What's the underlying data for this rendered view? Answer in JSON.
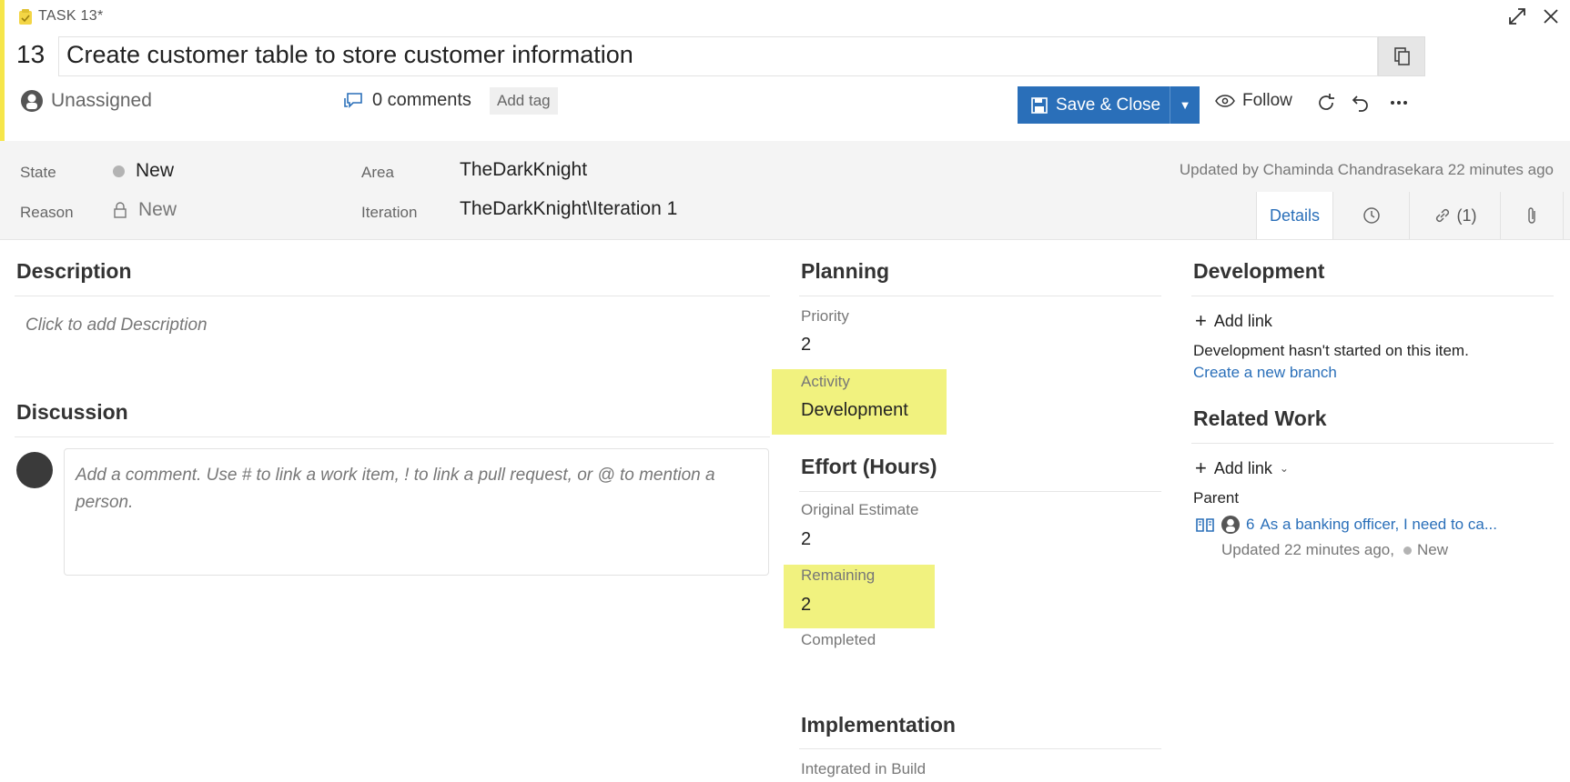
{
  "header": {
    "task_label": "TASK 13*",
    "work_item_id": "13",
    "title": "Create customer table to store customer information",
    "assigned_to": "Unassigned",
    "comments": "0 comments",
    "add_tag": "Add tag",
    "save_close": "Save & Close",
    "follow": "Follow"
  },
  "fields": {
    "state_label": "State",
    "state_value": "New",
    "reason_label": "Reason",
    "reason_value": "New",
    "area_label": "Area",
    "area_value": "TheDarkKnight",
    "iteration_label": "Iteration",
    "iteration_value": "TheDarkKnight\\Iteration 1",
    "updated_by": "Updated by Chaminda Chandrasekara 22 minutes ago"
  },
  "tabs": {
    "details": "Details",
    "links": "(1)"
  },
  "description": {
    "title": "Description",
    "placeholder": "Click to add Description"
  },
  "discussion": {
    "title": "Discussion",
    "placeholder": "Add a comment. Use # to link a work item, ! to link a pull request, or @ to mention a person."
  },
  "planning": {
    "title": "Planning",
    "priority_label": "Priority",
    "priority_value": "2",
    "activity_label": "Activity",
    "activity_value": "Development"
  },
  "effort": {
    "title": "Effort (Hours)",
    "original_label": "Original Estimate",
    "original_value": "2",
    "remaining_label": "Remaining",
    "remaining_value": "2",
    "completed_label": "Completed"
  },
  "implementation": {
    "title": "Implementation",
    "integrated_label": "Integrated in Build"
  },
  "development": {
    "title": "Development",
    "add_link": "Add link",
    "status_text": "Development hasn't started on this item.",
    "create_branch": "Create a new branch"
  },
  "related_work": {
    "title": "Related Work",
    "add_link": "Add link",
    "parent_label": "Parent",
    "parent_id": "6",
    "parent_title": "As a banking officer, I need to ca...",
    "parent_updated": "Updated 22 minutes ago,",
    "parent_state": "New"
  },
  "colors": {
    "accent": "#2a6fb9",
    "highlight": "#f1f27f",
    "task_bar": "#f6e64a"
  }
}
